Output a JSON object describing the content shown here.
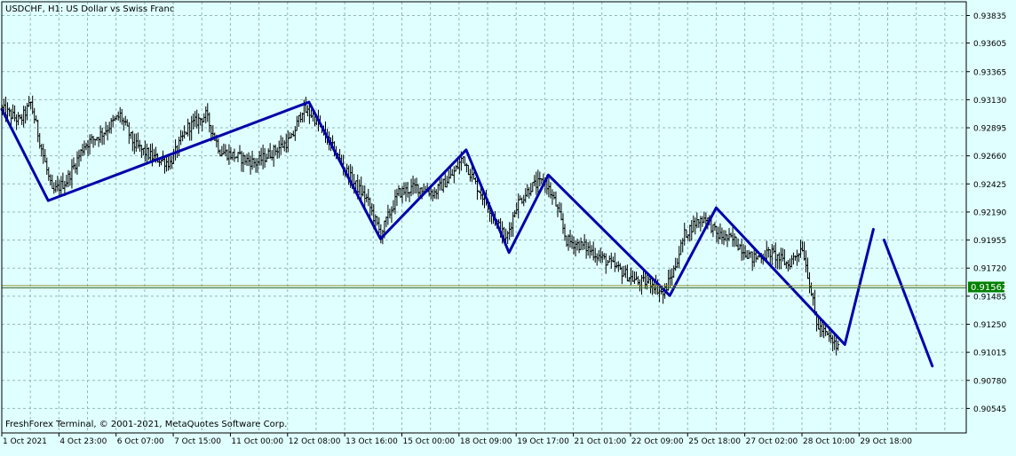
{
  "chart_data": {
    "type": "ohlc",
    "symbol_header": "USDCHF, H1:  US Dollar vs Swiss Franc",
    "copyright": "FreshForex Terminal, © 2001-2021, MetaQuotes Software Corp.",
    "current_price_label": "0.91562",
    "current_price": 0.91562,
    "ylim": [
      0.9034,
      0.9395
    ],
    "y_ticks": [
      "0.93835",
      "0.93605",
      "0.93365",
      "0.93130",
      "0.92895",
      "0.92660",
      "0.92425",
      "0.92190",
      "0.91955",
      "0.91720",
      "0.91485",
      "0.91250",
      "0.91015",
      "0.90780",
      "0.90545"
    ],
    "x_tick_labels": [
      "1 Oct 2021",
      "4 Oct 23:00",
      "6 Oct 07:00",
      "7 Oct 15:00",
      "11 Oct 00:00",
      "12 Oct 08:00",
      "13 Oct 16:00",
      "15 Oct 00:00",
      "18 Oct 09:00",
      "19 Oct 17:00",
      "21 Oct 01:00",
      "22 Oct 09:00",
      "25 Oct 18:00",
      "27 Oct 02:00",
      "28 Oct 10:00",
      "29 Oct 18:00"
    ],
    "x_tick_bar_index": [
      0,
      32,
      64,
      96,
      128,
      160,
      192,
      224,
      256,
      288,
      320,
      352,
      384,
      416,
      448,
      480
    ],
    "bar_count_span": 540,
    "last_bar_index": 468,
    "price_path": [
      [
        0,
        0.9305
      ],
      [
        10,
        0.9295
      ],
      [
        16,
        0.931
      ],
      [
        24,
        0.926
      ],
      [
        28,
        0.9235
      ],
      [
        36,
        0.9245
      ],
      [
        46,
        0.9275
      ],
      [
        56,
        0.9285
      ],
      [
        66,
        0.93
      ],
      [
        74,
        0.9275
      ],
      [
        84,
        0.9265
      ],
      [
        94,
        0.926
      ],
      [
        104,
        0.929
      ],
      [
        114,
        0.93
      ],
      [
        122,
        0.927
      ],
      [
        132,
        0.9265
      ],
      [
        142,
        0.926
      ],
      [
        152,
        0.927
      ],
      [
        162,
        0.928
      ],
      [
        168,
        0.9305
      ],
      [
        174,
        0.93
      ],
      [
        180,
        0.9285
      ],
      [
        188,
        0.9265
      ],
      [
        196,
        0.9245
      ],
      [
        204,
        0.923
      ],
      [
        212,
        0.92
      ],
      [
        216,
        0.9215
      ],
      [
        222,
        0.9235
      ],
      [
        232,
        0.924
      ],
      [
        242,
        0.9235
      ],
      [
        252,
        0.925
      ],
      [
        258,
        0.9265
      ],
      [
        264,
        0.9245
      ],
      [
        272,
        0.9225
      ],
      [
        282,
        0.9195
      ],
      [
        288,
        0.9225
      ],
      [
        296,
        0.924
      ],
      [
        304,
        0.9245
      ],
      [
        310,
        0.9225
      ],
      [
        316,
        0.9195
      ],
      [
        326,
        0.919
      ],
      [
        336,
        0.918
      ],
      [
        346,
        0.917
      ],
      [
        356,
        0.916
      ],
      [
        364,
        0.916
      ],
      [
        370,
        0.915
      ],
      [
        376,
        0.917
      ],
      [
        382,
        0.92
      ],
      [
        388,
        0.921
      ],
      [
        394,
        0.9215
      ],
      [
        400,
        0.92
      ],
      [
        410,
        0.9195
      ],
      [
        420,
        0.918
      ],
      [
        430,
        0.9185
      ],
      [
        440,
        0.9175
      ],
      [
        448,
        0.919
      ],
      [
        452,
        0.916
      ],
      [
        456,
        0.9125
      ],
      [
        462,
        0.9115
      ],
      [
        468,
        0.9105
      ],
      [
        474,
        0.9125
      ],
      [
        478,
        0.9165
      ],
      [
        482,
        0.916
      ]
    ],
    "zigzag": [
      [
        0,
        0.9305
      ],
      [
        26,
        0.92285
      ],
      [
        172,
        0.9311
      ],
      [
        212,
        0.91965
      ],
      [
        260,
        0.9271
      ],
      [
        284,
        0.9185
      ],
      [
        306,
        0.925
      ],
      [
        374,
        0.9149
      ],
      [
        400,
        0.92225
      ],
      [
        472,
        0.9108
      ],
      [
        488,
        0.92045
      ]
    ],
    "projection": [
      [
        494,
        0.91955
      ],
      [
        521,
        0.909
      ]
    ],
    "colors": {
      "background": "#e0ffff",
      "grid": "#8fbcbc",
      "bars": "#000000",
      "zigzag": "#0000aa",
      "price_line": "#3c6e32",
      "price_label_bg": "#008000",
      "price_label_fg": "#ffffff",
      "text": "#000000"
    }
  }
}
